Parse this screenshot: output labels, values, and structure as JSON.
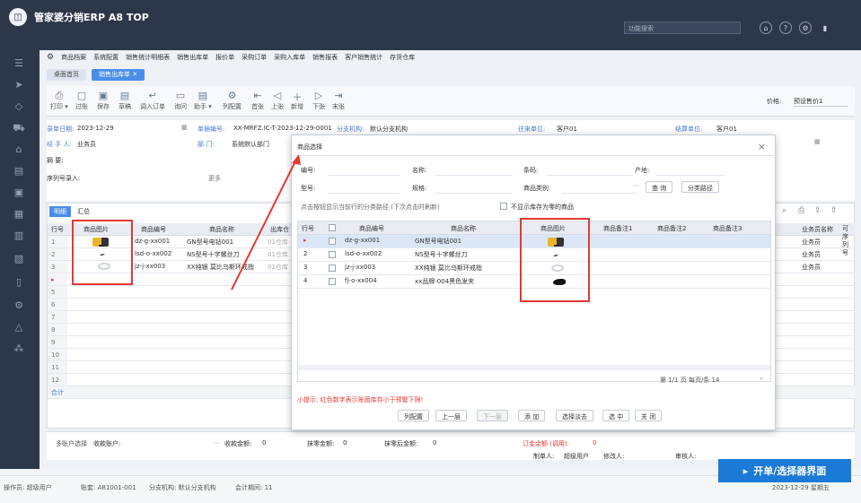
{
  "app": {
    "title": "管家婆分销ERP A8 TOP",
    "search_placeholder": "功能搜索"
  },
  "menu": {
    "items": [
      "商品档案",
      "系统配置",
      "销售统计明细表",
      "销售出库单",
      "报价单",
      "采购订单",
      "采购入库单",
      "销售报表",
      "客户销售统计",
      "存货仓库"
    ]
  },
  "tabs": [
    {
      "label": "桌面首页"
    },
    {
      "label": "销售出库单 ✕"
    }
  ],
  "toolbar": {
    "items": [
      "打印 ▾",
      "过账",
      "保存",
      "草稿",
      "调入订单",
      "询问",
      "助手 ▾",
      "列配置",
      "首张",
      "上张",
      "新增",
      "下张",
      "末张"
    ],
    "price_label": "价格:",
    "price_value": "预设售价1"
  },
  "form": {
    "date_label": "录单日期:",
    "date_value": "2023-12-29",
    "number_label": "单据编号:",
    "number_value": "XX-MRFZ.IC-T-2023-12-29-0001",
    "branch_label": "分支机构:",
    "branch_value": "默认分支机构",
    "unit_label": "往来单位:",
    "unit_value": "客户01",
    "settle_label": "结算单位:",
    "settle_value": "客户01",
    "handler_label": "经 手 人:",
    "handler_value": "业务员",
    "dept_label": "部 门:",
    "dept_value": "系统默认部门",
    "summary_label": "摘 要:",
    "serial_label": "序列号录入:",
    "more_label": "更多"
  },
  "grid": {
    "tabs": [
      "明细",
      "汇总"
    ],
    "headers": [
      "行号",
      "商品图片",
      "商品编号",
      "商品名称",
      "出库仓"
    ],
    "right_header": "业务员名称",
    "side_label": "可序列号",
    "rows": [
      {
        "no": "1",
        "code": "dz-g-xx001",
        "name": "GN型号电钻001",
        "store": "01仓库",
        "staff": "业务员"
      },
      {
        "no": "2",
        "code": "lsd-o-xx002",
        "name": "NS型号十字螺丝刀",
        "store": "01仓库",
        "staff": "业务员"
      },
      {
        "no": "3",
        "code": "jz-j-xx003",
        "name": "XX纯银 莫比乌斯环戒指",
        "store": "01仓库",
        "staff": "业务员"
      },
      {
        "no": "▸"
      },
      {
        "no": "5"
      },
      {
        "no": "6"
      },
      {
        "no": "7"
      },
      {
        "no": "8"
      },
      {
        "no": "9"
      },
      {
        "no": "10"
      },
      {
        "no": "11"
      },
      {
        "no": "12"
      }
    ],
    "total_label": "合计"
  },
  "footer": {
    "multi_account": "多账户选择",
    "receive_account": "收款账户:",
    "receive_amount": "收款金额:",
    "receive_amount_value": "0",
    "discount": "抹零金额:",
    "discount_value": "0",
    "after_discount": "抹零后金额:",
    "after_discount_value": "0",
    "order_amount": "订金余额 (调用):",
    "order_amount_value": "0",
    "maker_label": "制单人:",
    "maker_value": "超级用户",
    "modifier_label": "修改人:",
    "checker_label": "审核人:"
  },
  "status": {
    "operator": "操作员: 超级用户",
    "account": "账套: A81001-001",
    "branch": "分支机构: 默认分支机构",
    "period": "会计期间: 11",
    "date": "2023-12-29 星期五"
  },
  "modal": {
    "title": "商品选择",
    "close": "×",
    "fields": {
      "code": "编号:",
      "name": "名称:",
      "brand": "条码:",
      "origin": "产地:",
      "model": "型号:",
      "spec": "规格:",
      "category": "商品类别",
      "query": "查 询",
      "category_path": "分类路径"
    },
    "hint": "点击按钮显示当前行的分类路径 (下次点击时刷新)",
    "check_label": "不显示库存为零的商品",
    "headers": [
      "行号",
      "商品编号",
      "商品名称",
      "商品图片",
      "商品备注1",
      "商品备注2",
      "商品备注3"
    ],
    "rows": [
      {
        "no": "▸",
        "code": "dz-g-xx001",
        "name": "GN型号电钻001",
        "img": "drill"
      },
      {
        "no": "2",
        "code": "lsd-o-xx002",
        "name": "NS型号十字螺丝刀",
        "img": "screwdriver"
      },
      {
        "no": "3",
        "code": "jz-j-xx003",
        "name": "XX纯银 莫比乌斯环戒指",
        "img": "ring"
      },
      {
        "no": "4",
        "code": "fj-o-xx004",
        "name": "xx品牌-004黑色发夹",
        "img": "hairclip"
      }
    ],
    "pager": "第 1/1 页  每页/条  14",
    "warning": "小提示: 红色数字表示账面库存小于预警下限!",
    "buttons": [
      "列配置",
      "上一层",
      "下一层",
      "添 加",
      "选择淡去",
      "选 中",
      "关 闭"
    ]
  },
  "badge": {
    "text": "开单/选择器界面"
  },
  "colors": {
    "accent": "#4a8ee9",
    "topbar": "#2c3749",
    "highlight": "#e53935",
    "badge": "#1b7ad6"
  }
}
